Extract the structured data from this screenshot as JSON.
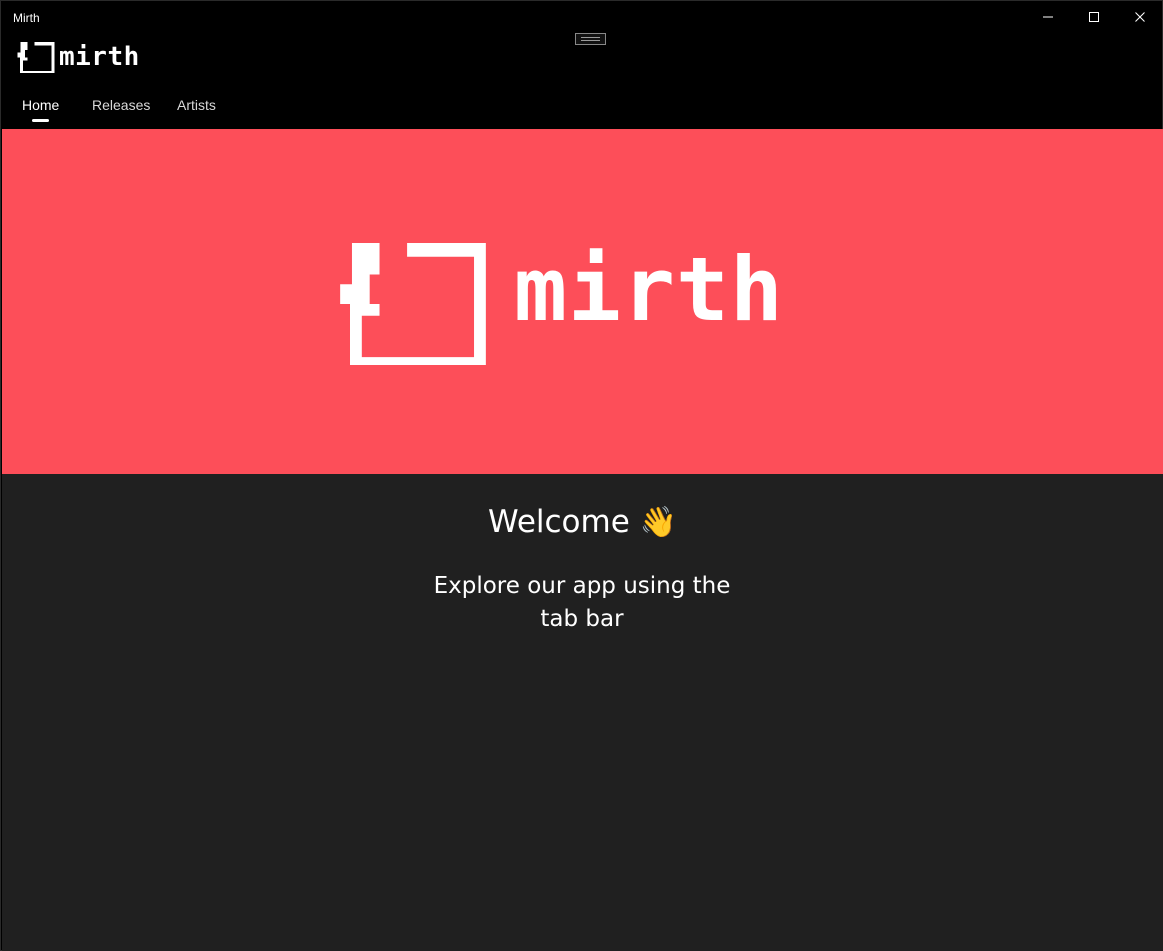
{
  "window": {
    "title": "Mirth"
  },
  "header": {
    "logo_text": "mirth"
  },
  "tabs": [
    {
      "label": "Home",
      "active": true
    },
    {
      "label": "Releases",
      "active": false
    },
    {
      "label": "Artists",
      "active": false
    }
  ],
  "hero": {
    "logo_text": "mirth",
    "background_color": "#fd4e59"
  },
  "main": {
    "welcome_text": "Welcome",
    "welcome_emoji": "👋",
    "subtitle": "Explore our app using the tab bar"
  },
  "colors": {
    "header_bg": "#000000",
    "content_bg": "#202020",
    "accent": "#fd4e59"
  }
}
